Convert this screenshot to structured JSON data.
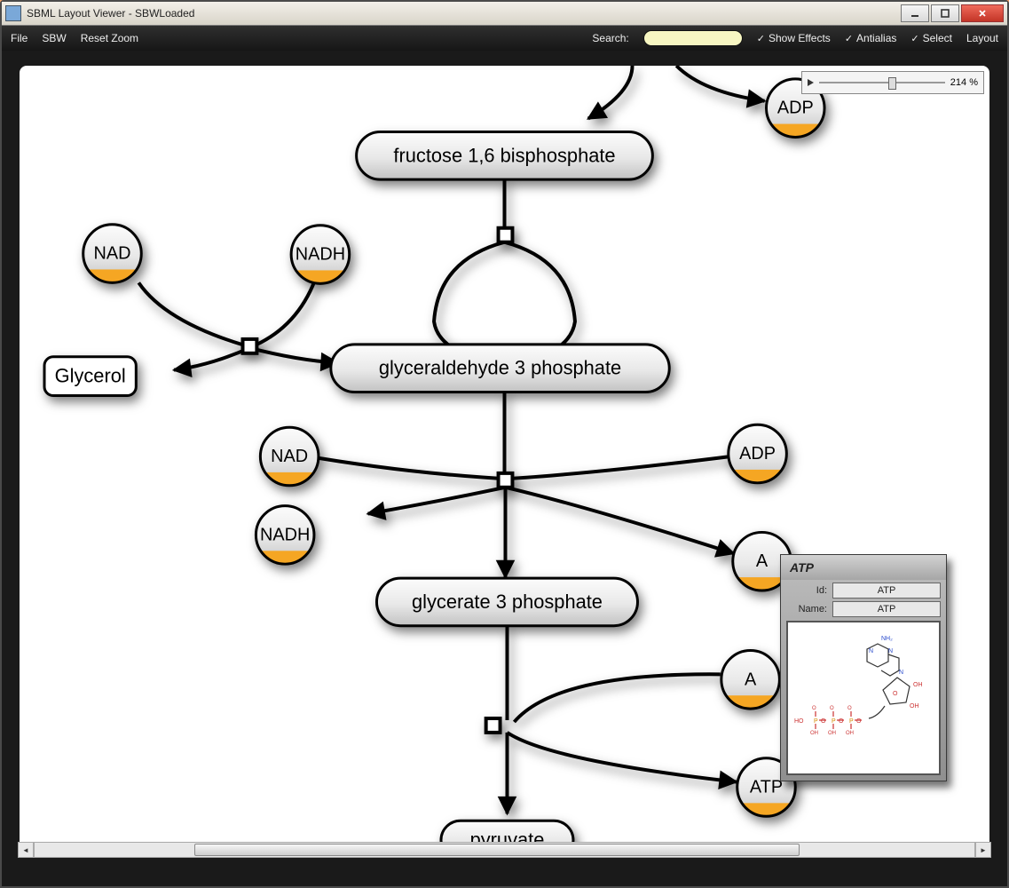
{
  "window": {
    "title": "SBML Layout Viewer - SBWLoaded"
  },
  "menu": {
    "file": "File",
    "sbw": "SBW",
    "reset": "Reset Zoom",
    "search_label": "Search:",
    "show_effects": "Show Effects",
    "antialias": "Antialias",
    "select": "Select",
    "layout": "Layout"
  },
  "zoom": {
    "value": "214 %"
  },
  "nodes": {
    "adp_top": "ADP",
    "fructose": "fructose 1,6 bisphosphate",
    "nad_a": "NAD",
    "nadh_a": "NADH",
    "glycerol": "Glycerol",
    "g3p": "glyceraldehyde 3 phosphate",
    "nad_b": "NAD",
    "adp_b": "ADP",
    "nadh_b": "NADH",
    "glyc3p": "glycerate 3 phosphate",
    "atp": "ATP",
    "pyruvate": "pyruvate"
  },
  "detail": {
    "title": "ATP",
    "id_label": "Id:",
    "id_value": "ATP",
    "name_label": "Name:",
    "name_value": "ATP"
  }
}
